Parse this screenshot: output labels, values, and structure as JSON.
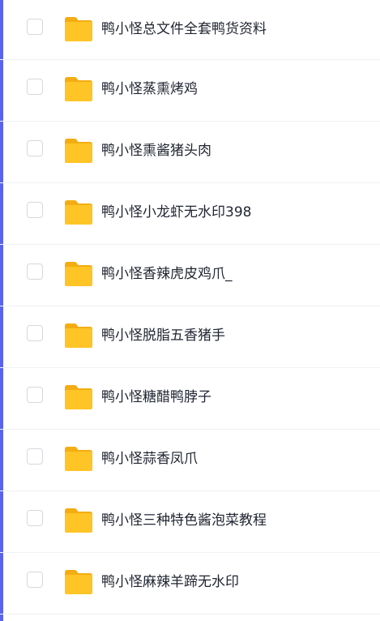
{
  "accent_color": "#5a63f0",
  "folder_color": "#ffc426",
  "files": [
    {
      "name": "鸭小怪总文件全套鸭货资料",
      "icon": "folder-icon"
    },
    {
      "name": "鸭小怪蒸熏烤鸡",
      "icon": "folder-icon"
    },
    {
      "name": "鸭小怪熏酱猪头肉",
      "icon": "folder-icon"
    },
    {
      "name": "鸭小怪小龙虾无水印398",
      "icon": "folder-icon"
    },
    {
      "name": "鸭小怪香辣虎皮鸡爪_",
      "icon": "folder-icon"
    },
    {
      "name": "鸭小怪脱脂五香猪手",
      "icon": "folder-icon"
    },
    {
      "name": "鸭小怪糖醋鸭脖子",
      "icon": "folder-icon"
    },
    {
      "name": "鸭小怪蒜香凤爪",
      "icon": "folder-icon"
    },
    {
      "name": "鸭小怪三种特色酱泡菜教程",
      "icon": "folder-icon"
    },
    {
      "name": "鸭小怪麻辣羊蹄无水印",
      "icon": "folder-icon"
    }
  ]
}
